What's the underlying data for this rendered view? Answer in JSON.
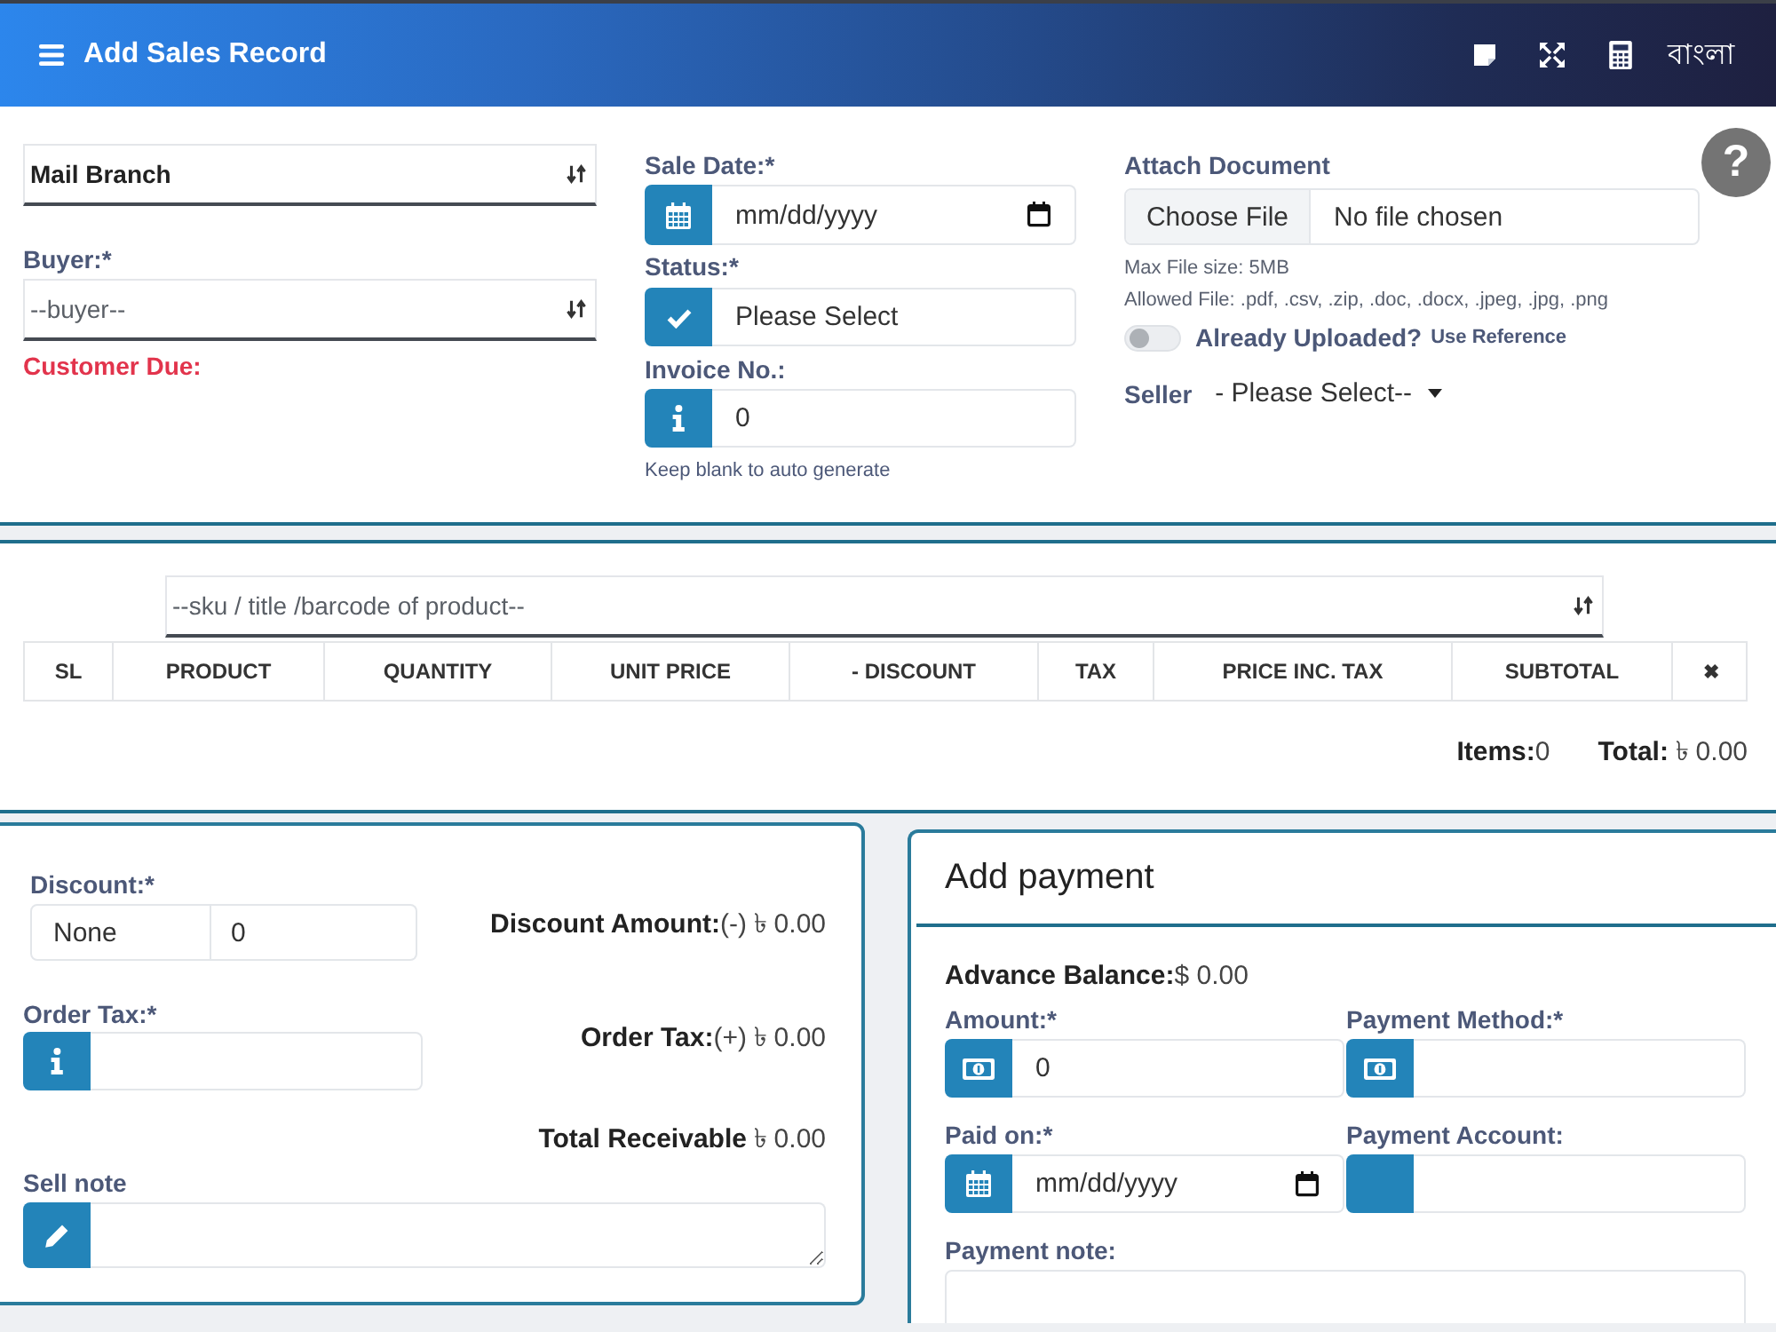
{
  "header": {
    "title": "Add Sales Record",
    "language": "বাংলা"
  },
  "sale_info": {
    "branch": {
      "value": "Mail Branch"
    },
    "buyer": {
      "label": "Buyer:*",
      "placeholder": "--buyer--"
    },
    "customer_due": {
      "label": "Customer Due:"
    },
    "sale_date": {
      "label": "Sale Date:*",
      "placeholder": "mm/dd/yyyy"
    },
    "status": {
      "label": "Status:*",
      "value": "Please Select"
    },
    "invoice_no": {
      "label": "Invoice No.:",
      "value": "0",
      "hint": "Keep blank to auto generate"
    },
    "attachment": {
      "label": "Attach Document",
      "button": "Choose File",
      "file_name": "No file chosen",
      "notes": [
        "Max File size: 5MB",
        "Allowed File: .pdf, .csv, .zip, .doc, .docx, .jpeg, .jpg, .png"
      ]
    },
    "already_uploaded": {
      "label": "Already Uploaded?",
      "hint": "Use Reference",
      "on": false
    },
    "seller": {
      "label": "Seller",
      "value": "- Please Select--"
    },
    "help": "?"
  },
  "products": {
    "search": {
      "placeholder": "--sku / title /barcode of product--"
    },
    "table": {
      "columns": [
        "SL",
        "PRODUCT",
        "QUANTITY",
        "UNIT PRICE",
        "- DISCOUNT",
        "TAX",
        "PRICE INC. TAX",
        "SUBTOTAL",
        "✖"
      ]
    },
    "items": "**Items:**0",
    "total": "**Total:** ৳ 0.00"
  },
  "summary": {
    "discount": {
      "label": "Discount:*",
      "type": "None",
      "value": "0"
    },
    "discount_amount": "**Discount Amount:**(-) ৳ 0.00",
    "order_tax": {
      "label": "Order Tax:*"
    },
    "order_tax_amount": "**Order Tax:**(+) ৳ 0.00",
    "total_receivable": "**Total Receivable** ৳ 0.00",
    "sell_note": {
      "label": "Sell note"
    }
  },
  "payment": {
    "title": "Add payment",
    "advance_balance": "**Advance Balance:**$ 0.00",
    "amount": {
      "label": "Amount:*",
      "value": "0"
    },
    "payment_method": {
      "label": "Payment Method:*"
    },
    "paid_on": {
      "label": "Paid on:*",
      "placeholder": "mm/dd/yyyy"
    },
    "payment_account": {
      "label": "Payment Account:"
    },
    "payment_note": {
      "label": "Payment note:"
    }
  }
}
